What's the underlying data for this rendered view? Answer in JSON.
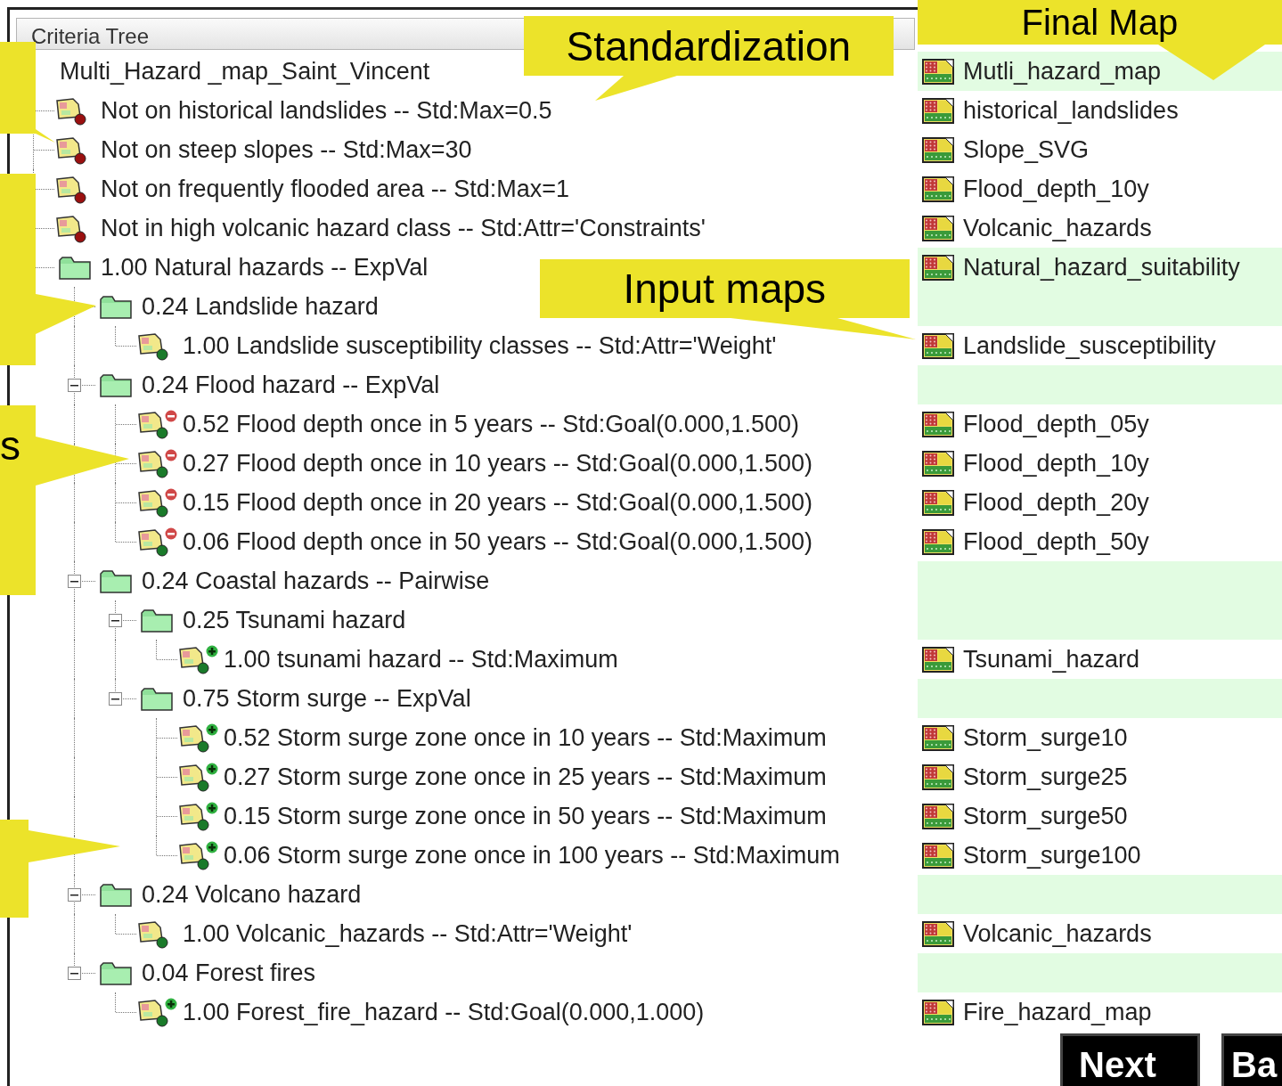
{
  "header": "Criteria Tree",
  "tree": {
    "kind": "root",
    "label": "Multi_Hazard _map_Saint_Vincent",
    "map": "Mutli_hazard_map",
    "children": [
      {
        "kind": "constraint",
        "label": "Not on historical landslides -- Std:Max=0.5",
        "map": "historical_landslides"
      },
      {
        "kind": "constraint",
        "label": "Not on steep slopes -- Std:Max=30",
        "map": "Slope_SVG"
      },
      {
        "kind": "constraint",
        "label": "Not on frequently flooded area -- Std:Max=1",
        "map": "Flood_depth_10y"
      },
      {
        "kind": "constraint",
        "label": "Not in high volcanic hazard class -- Std:Attr='Constraints'",
        "map": "Volcanic_hazards"
      },
      {
        "kind": "group",
        "label": "1.00 Natural hazards -- ExpVal",
        "map": "Natural_hazard_suitability",
        "children": [
          {
            "kind": "group",
            "label": "0.24 Landslide hazard",
            "children": [
              {
                "kind": "factor",
                "label": "1.00 Landslide susceptibility classes -- Std:Attr='Weight'",
                "map": "Landslide_susceptibility"
              }
            ]
          },
          {
            "kind": "group",
            "label": "0.24 Flood hazard -- ExpVal",
            "expanded": true,
            "children": [
              {
                "kind": "cost",
                "label": "0.52 Flood depth once in 5 years -- Std:Goal(0.000,1.500)",
                "map": "Flood_depth_05y"
              },
              {
                "kind": "cost",
                "label": "0.27 Flood depth once in 10 years -- Std:Goal(0.000,1.500)",
                "map": "Flood_depth_10y"
              },
              {
                "kind": "cost",
                "label": "0.15 Flood depth once in 20 years -- Std:Goal(0.000,1.500)",
                "map": "Flood_depth_20y"
              },
              {
                "kind": "cost",
                "label": "0.06 Flood depth once in 50 years -- Std:Goal(0.000,1.500)",
                "map": "Flood_depth_50y"
              }
            ]
          },
          {
            "kind": "group",
            "label": "0.24 Coastal hazards -- Pairwise",
            "expanded": true,
            "children": [
              {
                "kind": "group",
                "label": "0.25 Tsunami hazard",
                "expanded": true,
                "children": [
                  {
                    "kind": "benefit",
                    "label": "1.00 tsunami hazard -- Std:Maximum",
                    "map": "Tsunami_hazard"
                  }
                ]
              },
              {
                "kind": "group",
                "label": "0.75 Storm surge -- ExpVal",
                "expanded": true,
                "children": [
                  {
                    "kind": "benefit",
                    "label": "0.52 Storm surge zone once in 10 years -- Std:Maximum",
                    "map": "Storm_surge10"
                  },
                  {
                    "kind": "benefit",
                    "label": "0.27 Storm surge zone once in 25 years -- Std:Maximum",
                    "map": "Storm_surge25"
                  },
                  {
                    "kind": "benefit",
                    "label": "0.15 Storm surge zone once in 50 years -- Std:Maximum",
                    "map": "Storm_surge50"
                  },
                  {
                    "kind": "benefit",
                    "label": "0.06 Storm surge zone once in 100 years -- Std:Maximum",
                    "map": "Storm_surge100"
                  }
                ]
              }
            ]
          },
          {
            "kind": "group",
            "label": "0.24 Volcano hazard",
            "expanded": true,
            "children": [
              {
                "kind": "factor",
                "label": "1.00 Volcanic_hazards -- Std:Attr='Weight'",
                "map": "Volcanic_hazards"
              }
            ]
          },
          {
            "kind": "group",
            "label": "0.04 Forest fires",
            "expanded": true,
            "children": [
              {
                "kind": "benefit",
                "label": "1.00 Forest_fire_hazard -- Std:Goal(0.000,1.000)",
                "map": "Fire_hazard_map"
              }
            ]
          }
        ]
      }
    ]
  },
  "buttons": [
    {
      "label": "Next"
    },
    {
      "label": "Ba"
    }
  ],
  "callouts": [
    {
      "text": "Standardization"
    },
    {
      "text": "Final Map"
    },
    {
      "text": "Input maps"
    },
    {
      "text": "s"
    }
  ]
}
